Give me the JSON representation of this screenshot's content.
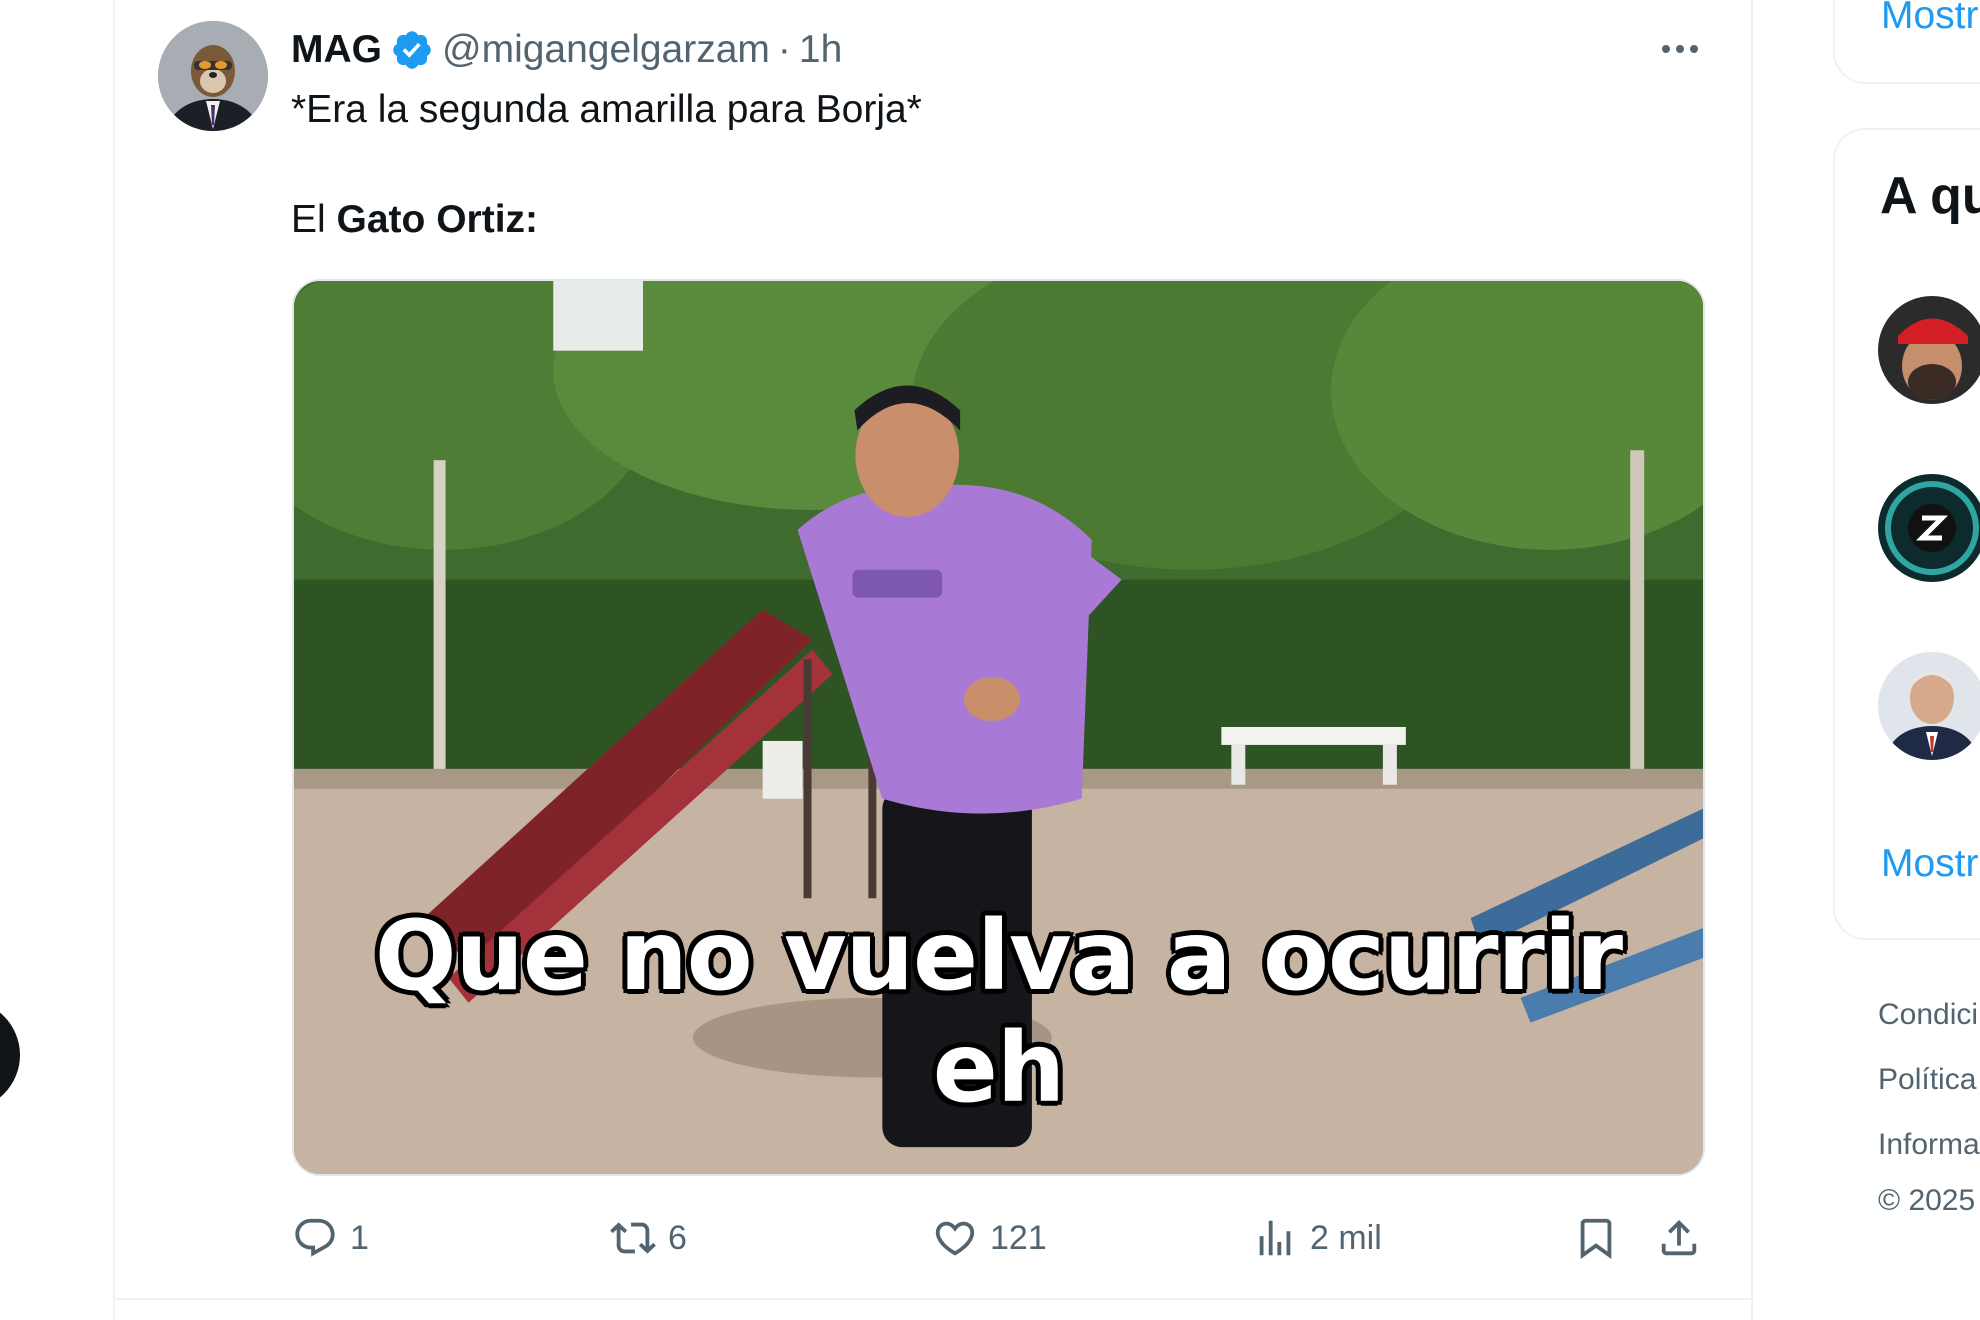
{
  "tweet": {
    "author_name": "MAG",
    "handle": "@migangelgarzam",
    "separator": "·",
    "time": "1h",
    "text_line1": "*Era la segunda amarilla para Borja*",
    "text_line2_prefix": "El",
    "text_line2_bold": "Gato Ortiz:",
    "media_caption": "Que no vuelva a ocurrir eh"
  },
  "actions": {
    "replies": "1",
    "retweets": "6",
    "likes": "121",
    "views": "2 mil"
  },
  "icons": {
    "verified": "verified-badge-icon",
    "more": "more-options-icon",
    "reply": "reply-icon",
    "retweet": "retweet-icon",
    "like": "heart-icon",
    "views": "views-chart-icon",
    "bookmark": "bookmark-icon",
    "share": "share-icon"
  },
  "sidebar": {
    "top_link": "Mostr",
    "who_to_follow_title": "A qu",
    "show_more": "Mostr",
    "footer": [
      "Condici",
      "Política",
      "Informa",
      "© 2025"
    ]
  },
  "colors": {
    "accent": "#1d9bf0",
    "text": "#0f1419",
    "muted": "#536471",
    "border": "#eff3f4"
  }
}
